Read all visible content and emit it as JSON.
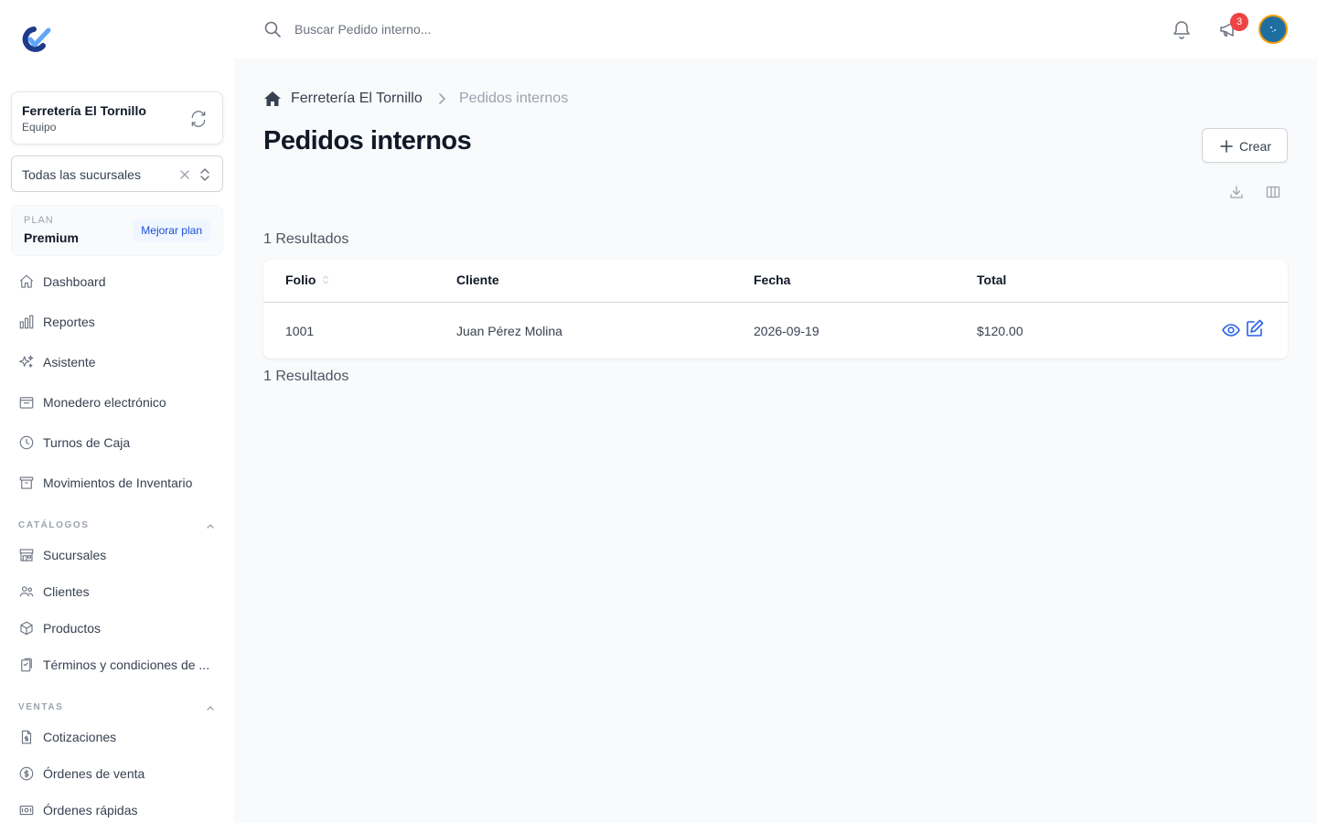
{
  "sidebar": {
    "team": {
      "name": "Ferretería El Tornillo",
      "role": "Equipo"
    },
    "branch_select": {
      "value": "Todas las sucursales"
    },
    "plan": {
      "label": "PLAN",
      "name": "Premium",
      "upgrade_label": "Mejorar plan"
    },
    "nav": [
      {
        "label": "Dashboard",
        "icon": "home-icon"
      },
      {
        "label": "Reportes",
        "icon": "chart-icon"
      },
      {
        "label": "Asistente",
        "icon": "sparkles-icon"
      },
      {
        "label": "Monedero electrónico",
        "icon": "wallet-icon"
      },
      {
        "label": "Turnos de Caja",
        "icon": "clock-icon"
      },
      {
        "label": "Movimientos de Inventario",
        "icon": "archive-icon"
      }
    ],
    "sections": [
      {
        "title": "CATÁLOGOS",
        "items": [
          {
            "label": "Sucursales",
            "icon": "store-icon"
          },
          {
            "label": "Clientes",
            "icon": "users-icon"
          },
          {
            "label": "Productos",
            "icon": "cube-icon"
          },
          {
            "label": "Términos y condiciones de ...",
            "icon": "clipboard-icon"
          }
        ]
      },
      {
        "title": "VENTAS",
        "items": [
          {
            "label": "Cotizaciones",
            "icon": "document-dollar-icon"
          },
          {
            "label": "Órdenes de venta",
            "icon": "dollar-circle-icon"
          },
          {
            "label": "Órdenes rápidas",
            "icon": "cash-icon"
          }
        ]
      }
    ]
  },
  "topbar": {
    "search_placeholder": "Buscar Pedido interno...",
    "notifications_badge": "3"
  },
  "breadcrumb": {
    "team": "Ferretería El Tornillo",
    "current": "Pedidos internos"
  },
  "page": {
    "title": "Pedidos internos",
    "create_label": "Crear",
    "results_top": "1 Resultados",
    "results_bottom": "1 Resultados"
  },
  "table": {
    "columns": [
      "Folio",
      "Cliente",
      "Fecha",
      "Total"
    ],
    "rows": [
      {
        "folio": "1001",
        "cliente": "Juan Pérez Molina",
        "fecha": "2026-09-19",
        "total": "$120.00"
      }
    ]
  },
  "colors": {
    "accent": "#2563eb",
    "badge": "#ef4444",
    "sidebar_bg": "#ffffff",
    "main_bg": "#f9fafb"
  }
}
